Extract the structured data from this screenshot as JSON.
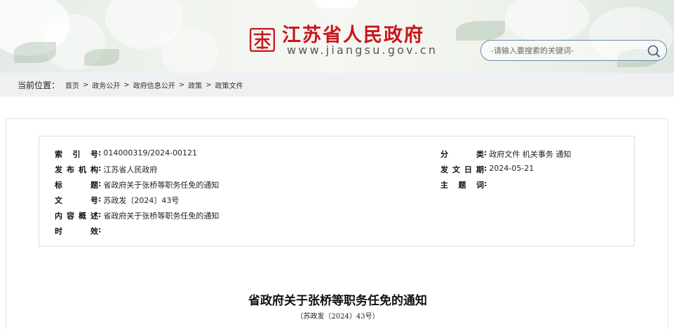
{
  "header": {
    "site_name": "江苏省人民政府",
    "site_url": "www.jiangsu.gov.cn",
    "search": {
      "placeholder": "-请输入要搜索的关键词-"
    }
  },
  "breadcrumb": {
    "label": "当前位置：",
    "items": [
      "首页",
      "政务公开",
      "政府信息公开",
      "政策",
      "政策文件"
    ],
    "separator": ">"
  },
  "meta": {
    "index_no": {
      "label": "索 引 号",
      "value": "014000319/2024-00121"
    },
    "publisher": {
      "label": "发布机构",
      "value": "江苏省人民政府"
    },
    "title": {
      "label": "标    题",
      "value": "省政府关于张桥等职务任免的通知"
    },
    "doc_no": {
      "label": "文    号",
      "value": "苏政发〔2024〕43号"
    },
    "summary": {
      "label": "内容概述",
      "value": "省政府关于张桥等职务任免的通知"
    },
    "validity": {
      "label": "时    效",
      "value": ""
    },
    "category": {
      "label": "分    类",
      "value": "政府文件 机关事务 通知"
    },
    "issue_date": {
      "label": "发文日期",
      "value": "2024-05-21"
    },
    "subject": {
      "label": "主 题 词",
      "value": ""
    }
  },
  "document": {
    "title": "省政府关于张桥等职务任免的通知",
    "subtitle": "（苏政发〔2024〕43号）"
  },
  "colors": {
    "brand_red": "#c8161d",
    "search_border": "#6b89a8"
  }
}
